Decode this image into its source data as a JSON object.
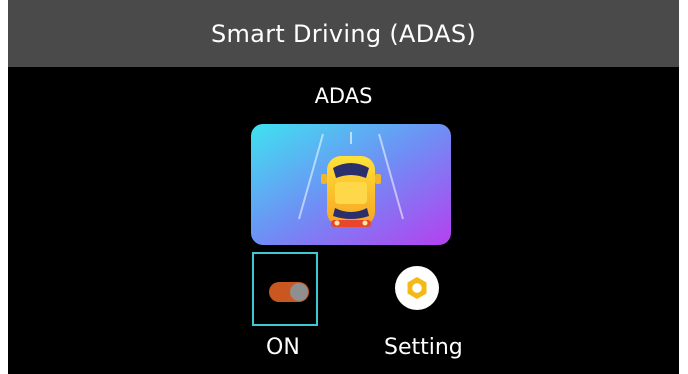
{
  "header": {
    "title": "Smart Driving (ADAS)"
  },
  "feature": {
    "label": "ADAS",
    "illustration_icon": "car-lane-icon"
  },
  "controls": {
    "toggle": {
      "label": "ON",
      "state": "on",
      "icon": "toggle-switch-icon"
    },
    "settings": {
      "label": "Setting",
      "icon": "gear-icon"
    }
  },
  "colors": {
    "title_bar": "#4a4a4a",
    "background": "#000000",
    "focus_border": "#3fc8d4",
    "toggle_track": "#c9571f",
    "gear": "#f5b915"
  }
}
